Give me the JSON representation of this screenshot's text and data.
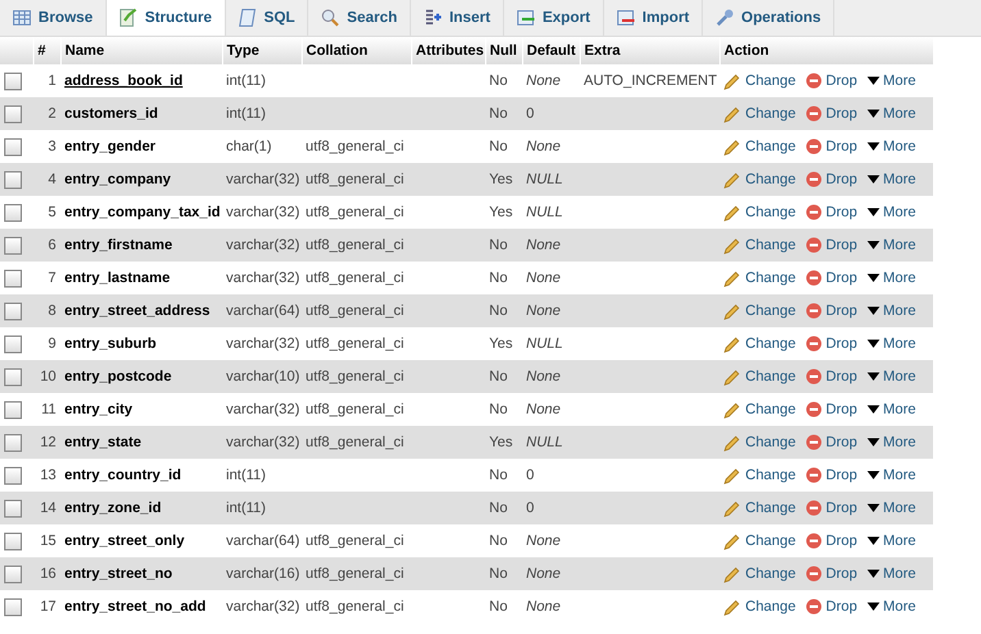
{
  "tabs": [
    {
      "label": "Browse",
      "selected": false
    },
    {
      "label": "Structure",
      "selected": true
    },
    {
      "label": "SQL",
      "selected": false
    },
    {
      "label": "Search",
      "selected": false
    },
    {
      "label": "Insert",
      "selected": false
    },
    {
      "label": "Export",
      "selected": false
    },
    {
      "label": "Import",
      "selected": false
    },
    {
      "label": "Operations",
      "selected": false
    }
  ],
  "table": {
    "columns": [
      "#",
      "Name",
      "Type",
      "Collation",
      "Attributes",
      "Null",
      "Default",
      "Extra",
      "Action"
    ],
    "rows": [
      {
        "num": "1",
        "name": "address_book_id",
        "primary": true,
        "type": "int(11)",
        "collation": "",
        "null": "No",
        "default": "None",
        "default_italic": true,
        "extra": "AUTO_INCREMENT",
        "checked": false,
        "actions": [
          "Change",
          "Drop",
          "More"
        ]
      },
      {
        "num": "2",
        "name": "customers_id",
        "primary": false,
        "type": "int(11)",
        "collation": "",
        "null": "No",
        "default": "0",
        "default_italic": false,
        "extra": "",
        "checked": false,
        "actions": [
          "Change",
          "Drop",
          "More"
        ]
      },
      {
        "num": "3",
        "name": "entry_gender",
        "primary": false,
        "type": "char(1)",
        "collation": "utf8_general_ci",
        "null": "No",
        "default": "None",
        "default_italic": true,
        "extra": "",
        "checked": false,
        "actions": [
          "Change",
          "Drop",
          "More"
        ]
      },
      {
        "num": "4",
        "name": "entry_company",
        "primary": false,
        "type": "varchar(32)",
        "collation": "utf8_general_ci",
        "null": "Yes",
        "default": "NULL",
        "default_italic": true,
        "extra": "",
        "checked": false,
        "actions": [
          "Change",
          "Drop",
          "More"
        ]
      },
      {
        "num": "5",
        "name": "entry_company_tax_id",
        "primary": false,
        "type": "varchar(32)",
        "collation": "utf8_general_ci",
        "null": "Yes",
        "default": "NULL",
        "default_italic": true,
        "extra": "",
        "checked": false,
        "actions": [
          "Change",
          "Drop",
          "More"
        ]
      },
      {
        "num": "6",
        "name": "entry_firstname",
        "primary": false,
        "type": "varchar(32)",
        "collation": "utf8_general_ci",
        "null": "No",
        "default": "None",
        "default_italic": true,
        "extra": "",
        "checked": false,
        "actions": [
          "Change",
          "Drop",
          "More"
        ]
      },
      {
        "num": "7",
        "name": "entry_lastname",
        "primary": false,
        "type": "varchar(32)",
        "collation": "utf8_general_ci",
        "null": "No",
        "default": "None",
        "default_italic": true,
        "extra": "",
        "checked": false,
        "actions": [
          "Change",
          "Drop",
          "More"
        ]
      },
      {
        "num": "8",
        "name": "entry_street_address",
        "primary": false,
        "type": "varchar(64)",
        "collation": "utf8_general_ci",
        "null": "No",
        "default": "None",
        "default_italic": true,
        "extra": "",
        "checked": false,
        "actions": [
          "Change",
          "Drop",
          "More"
        ]
      },
      {
        "num": "9",
        "name": "entry_suburb",
        "primary": false,
        "type": "varchar(32)",
        "collation": "utf8_general_ci",
        "null": "Yes",
        "default": "NULL",
        "default_italic": true,
        "extra": "",
        "checked": false,
        "actions": [
          "Change",
          "Drop",
          "More"
        ]
      },
      {
        "num": "10",
        "name": "entry_postcode",
        "primary": false,
        "type": "varchar(10)",
        "collation": "utf8_general_ci",
        "null": "No",
        "default": "None",
        "default_italic": true,
        "extra": "",
        "checked": false,
        "actions": [
          "Change",
          "Drop",
          "More"
        ]
      },
      {
        "num": "11",
        "name": "entry_city",
        "primary": false,
        "type": "varchar(32)",
        "collation": "utf8_general_ci",
        "null": "No",
        "default": "None",
        "default_italic": true,
        "extra": "",
        "checked": false,
        "actions": [
          "Change",
          "Drop",
          "More"
        ]
      },
      {
        "num": "12",
        "name": "entry_state",
        "primary": false,
        "type": "varchar(32)",
        "collation": "utf8_general_ci",
        "null": "Yes",
        "default": "NULL",
        "default_italic": true,
        "extra": "",
        "checked": false,
        "actions": [
          "Change",
          "Drop",
          "More"
        ]
      },
      {
        "num": "13",
        "name": "entry_country_id",
        "primary": false,
        "type": "int(11)",
        "collation": "",
        "null": "No",
        "default": "0",
        "default_italic": false,
        "extra": "",
        "checked": false,
        "actions": [
          "Change",
          "Drop",
          "More"
        ]
      },
      {
        "num": "14",
        "name": "entry_zone_id",
        "primary": false,
        "type": "int(11)",
        "collation": "",
        "null": "No",
        "default": "0",
        "default_italic": false,
        "extra": "",
        "checked": false,
        "actions": [
          "Change",
          "Drop",
          "More"
        ]
      },
      {
        "num": "15",
        "name": "entry_street_only",
        "primary": false,
        "type": "varchar(64)",
        "collation": "utf8_general_ci",
        "null": "No",
        "default": "None",
        "default_italic": true,
        "extra": "",
        "checked": false,
        "actions": [
          "Change",
          "Drop",
          "More"
        ]
      },
      {
        "num": "16",
        "name": "entry_street_no",
        "primary": false,
        "type": "varchar(16)",
        "collation": "utf8_general_ci",
        "null": "No",
        "default": "None",
        "default_italic": true,
        "extra": "",
        "checked": false,
        "actions": [
          "Change",
          "Drop",
          "More"
        ]
      },
      {
        "num": "17",
        "name": "entry_street_no_add",
        "primary": false,
        "type": "varchar(32)",
        "collation": "utf8_general_ci",
        "null": "No",
        "default": "None",
        "default_italic": true,
        "extra": "",
        "checked": false,
        "actions": [
          "Change",
          "Drop",
          "More"
        ]
      }
    ]
  }
}
